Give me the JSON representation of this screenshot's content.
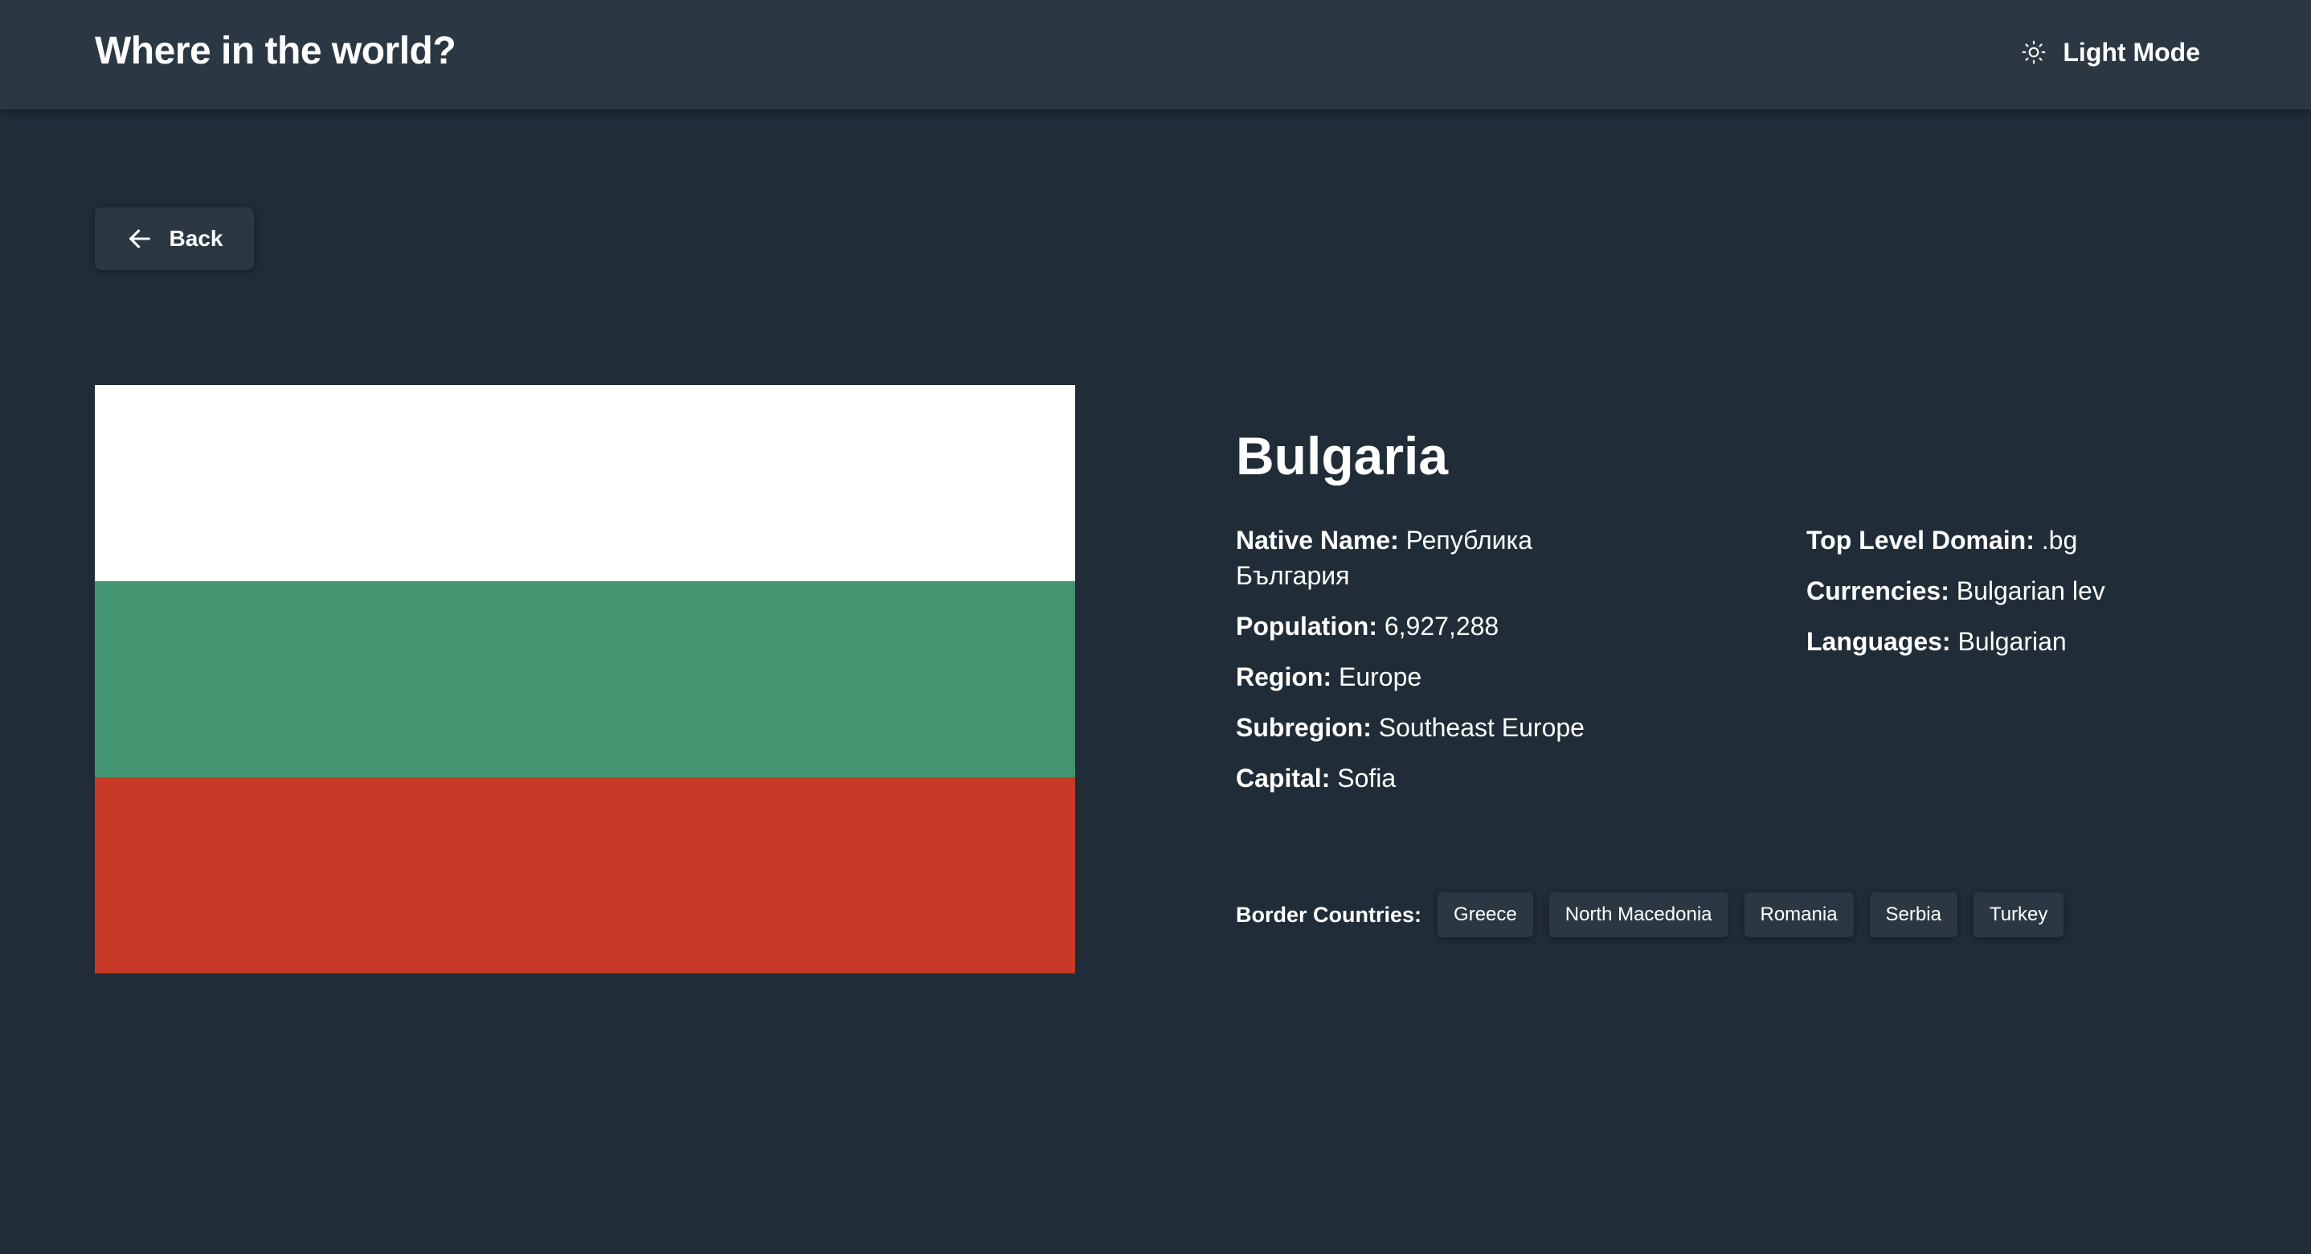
{
  "header": {
    "title": "Where in the world?",
    "theme_toggle": {
      "label": "Light Mode",
      "icon": "sun-icon"
    }
  },
  "back_button": {
    "label": "Back",
    "icon": "arrow-left-icon"
  },
  "country": {
    "name": "Bulgaria",
    "flag": {
      "description_icon": "flag-image",
      "stripes": [
        "#ffffff",
        "#439471",
        "#c63926"
      ]
    },
    "details_left": [
      {
        "key": "Native Name:",
        "value": "Република България"
      },
      {
        "key": "Population:",
        "value": "6,927,288"
      },
      {
        "key": "Region:",
        "value": "Europe"
      },
      {
        "key": "Subregion:",
        "value": "Southeast Europe"
      },
      {
        "key": "Capital:",
        "value": "Sofia"
      }
    ],
    "details_right": [
      {
        "key": "Top Level Domain:",
        "value": ".bg"
      },
      {
        "key": "Currencies:",
        "value": "Bulgarian lev"
      },
      {
        "key": "Languages:",
        "value": "Bulgarian"
      }
    ],
    "border_label": "Border Countries:",
    "borders": [
      "Greece",
      "North Macedonia",
      "Romania",
      "Serbia",
      "Turkey"
    ]
  },
  "colors": {
    "background": "#202c37",
    "element": "#2b3844",
    "text": "#ffffff"
  }
}
